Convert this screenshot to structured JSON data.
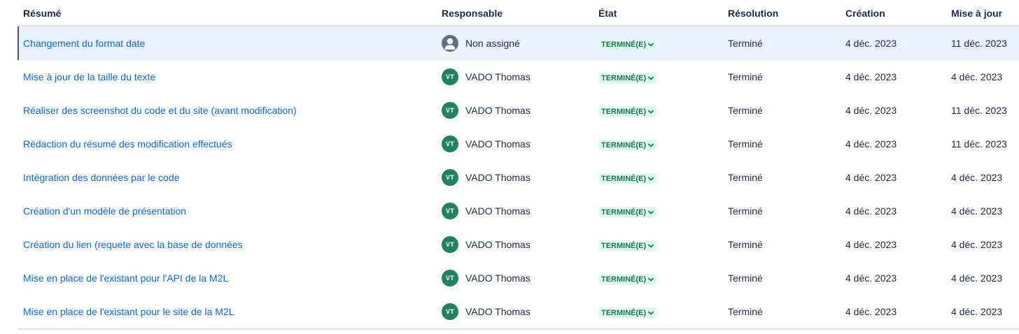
{
  "headers": {
    "summary": "Résumé",
    "assignee": "Responsable",
    "status": "État",
    "resolution": "Résolution",
    "created": "Création",
    "updated": "Mise à jour"
  },
  "colors": {
    "link": "#0c66e4",
    "selected_row_bg": "#e9f2ff",
    "avatar_bg": "#1f845a",
    "status_bg": "#dcfff1",
    "status_text": "#216e4e"
  },
  "rows": [
    {
      "summary": "Changement du format date",
      "assignee": "Non assigné",
      "initials": "",
      "status": "TERMINÉ(E)",
      "resolution": "Terminé",
      "created": "4 déc. 2023",
      "updated": "11 déc. 2023"
    },
    {
      "summary": "Mise à jour de la taille du texte",
      "assignee": "VADO Thomas",
      "initials": "VT",
      "status": "TERMINÉ(E)",
      "resolution": "Terminé",
      "created": "4 déc. 2023",
      "updated": "4 déc. 2023"
    },
    {
      "summary": "Réaliser des screenshot du code et du site (avant modification)",
      "assignee": "VADO Thomas",
      "initials": "VT",
      "status": "TERMINÉ(E)",
      "resolution": "Terminé",
      "created": "4 déc. 2023",
      "updated": "11 déc. 2023"
    },
    {
      "summary": "Rédaction du résumé des modification effectués",
      "assignee": "VADO Thomas",
      "initials": "VT",
      "status": "TERMINÉ(E)",
      "resolution": "Terminé",
      "created": "4 déc. 2023",
      "updated": "11 déc. 2023"
    },
    {
      "summary": "Intégration des données par le code",
      "assignee": "VADO Thomas",
      "initials": "VT",
      "status": "TERMINÉ(E)",
      "resolution": "Terminé",
      "created": "4 déc. 2023",
      "updated": "4 déc. 2023"
    },
    {
      "summary": "Création d'un modèle de présentation",
      "assignee": "VADO Thomas",
      "initials": "VT",
      "status": "TERMINÉ(E)",
      "resolution": "Terminé",
      "created": "4 déc. 2023",
      "updated": "4 déc. 2023"
    },
    {
      "summary": "Création du lien (requete avec la base de données",
      "assignee": "VADO Thomas",
      "initials": "VT",
      "status": "TERMINÉ(E)",
      "resolution": "Terminé",
      "created": "4 déc. 2023",
      "updated": "4 déc. 2023"
    },
    {
      "summary": "Mise en place de l'existant pour l'API de la M2L",
      "assignee": "VADO Thomas",
      "initials": "VT",
      "status": "TERMINÉ(E)",
      "resolution": "Terminé",
      "created": "4 déc. 2023",
      "updated": "4 déc. 2023"
    },
    {
      "summary": "Mise en place de l'existant pour le site de la M2L",
      "assignee": "VADO Thomas",
      "initials": "VT",
      "status": "TERMINÉ(E)",
      "resolution": "Terminé",
      "created": "4 déc. 2023",
      "updated": "4 déc. 2023"
    }
  ]
}
